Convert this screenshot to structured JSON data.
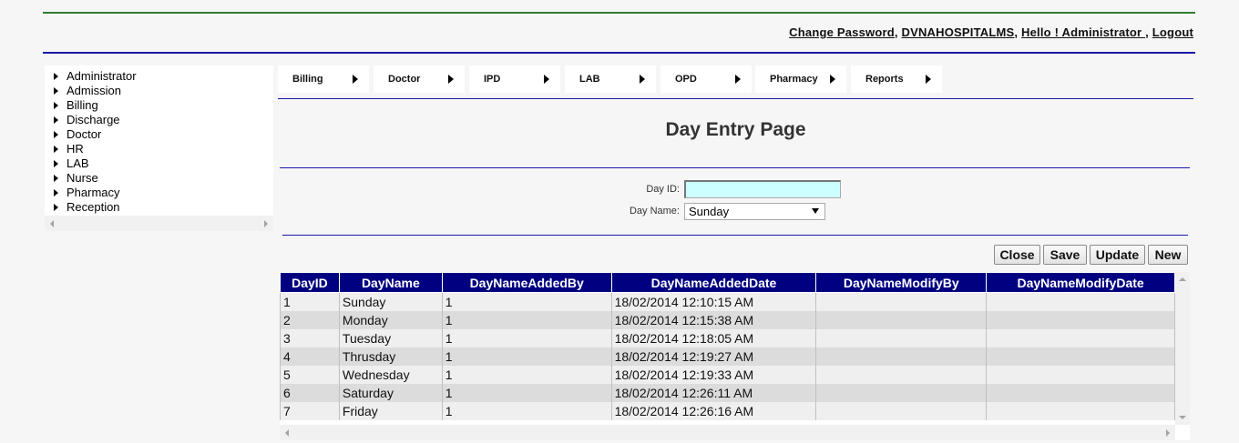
{
  "header": {
    "change_password": "Change Password",
    "sep1": ",",
    "hospital": "DVNAHOSPITALMS",
    "sep2": ",",
    "greeting": "Hello ! Administrator ",
    "sep3": ",",
    "logout": "Logout"
  },
  "sidebar": {
    "items": [
      {
        "label": "Administrator"
      },
      {
        "label": "Admission"
      },
      {
        "label": "Billing"
      },
      {
        "label": "Discharge"
      },
      {
        "label": "Doctor"
      },
      {
        "label": "HR"
      },
      {
        "label": "LAB"
      },
      {
        "label": "Nurse"
      },
      {
        "label": "Pharmacy"
      },
      {
        "label": "Reception"
      }
    ]
  },
  "menu": {
    "items": [
      {
        "label": "Billing"
      },
      {
        "label": "Doctor"
      },
      {
        "label": "IPD"
      },
      {
        "label": "LAB"
      },
      {
        "label": "OPD"
      },
      {
        "label": "Pharmacy"
      },
      {
        "label": "Reports"
      }
    ]
  },
  "page": {
    "title": "Day Entry Page"
  },
  "form": {
    "day_id_label": "Day ID:",
    "day_id_value": "",
    "day_name_label": "Day Name:",
    "day_name_selected": "Sunday"
  },
  "buttons": {
    "close": "Close",
    "save": "Save",
    "update": "Update",
    "new": "New"
  },
  "grid": {
    "columns": [
      "DayID",
      "DayName",
      "DayNameAddedBy",
      "DayNameAddedDate",
      "DayNameModifyBy",
      "DayNameModifyDate"
    ],
    "rows": [
      {
        "id": "1",
        "name": "Sunday",
        "added_by": "1",
        "added_date": "18/02/2014 12:10:15 AM",
        "modify_by": "",
        "modify_date": ""
      },
      {
        "id": "2",
        "name": "Monday",
        "added_by": "1",
        "added_date": "18/02/2014 12:15:38 AM",
        "modify_by": "",
        "modify_date": ""
      },
      {
        "id": "3",
        "name": "Tuesday",
        "added_by": "1",
        "added_date": "18/02/2014 12:18:05 AM",
        "modify_by": "",
        "modify_date": ""
      },
      {
        "id": "4",
        "name": "Thrusday",
        "added_by": "1",
        "added_date": "18/02/2014 12:19:27 AM",
        "modify_by": "",
        "modify_date": ""
      },
      {
        "id": "5",
        "name": "Wednesday",
        "added_by": "1",
        "added_date": "18/02/2014 12:19:33 AM",
        "modify_by": "",
        "modify_date": ""
      },
      {
        "id": "6",
        "name": "Saturday",
        "added_by": "1",
        "added_date": "18/02/2014 12:26:11 AM",
        "modify_by": "",
        "modify_date": ""
      },
      {
        "id": "7",
        "name": "Friday",
        "added_by": "1",
        "added_date": "18/02/2014 12:26:16 AM",
        "modify_by": "",
        "modify_date": ""
      }
    ]
  },
  "colors": {
    "header_green": "#2e7d32",
    "rule_blue": "#1a1aa6",
    "grid_header_bg": "#000080",
    "input_bg": "#ccffff"
  },
  "icons": {
    "menu_arrow": "triangle-right-icon",
    "select_caret": "triangle-down-icon"
  }
}
